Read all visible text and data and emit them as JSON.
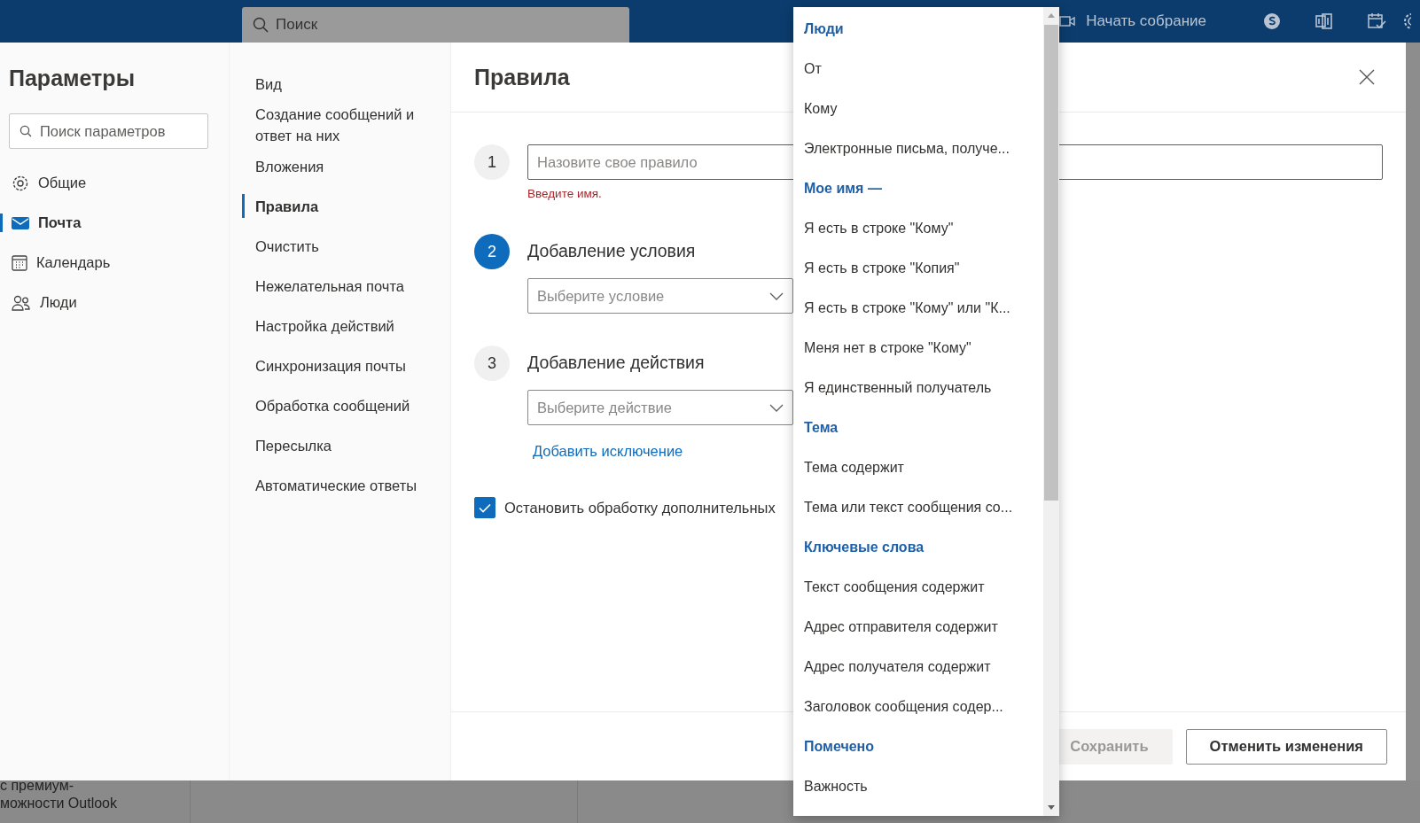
{
  "top_bar": {
    "search": {
      "placeholder": "Поиск"
    },
    "meeting_button": "Начать собрание"
  },
  "settings": {
    "title": "Параметры",
    "search": {
      "placeholder": "Поиск параметров"
    },
    "categories": [
      {
        "label": "Общие",
        "selected": false
      },
      {
        "label": "Почта",
        "selected": true
      },
      {
        "label": "Календарь",
        "selected": false
      },
      {
        "label": "Люди",
        "selected": false
      }
    ]
  },
  "sections": [
    {
      "label": "Вид",
      "selected": false
    },
    {
      "label": "Создание сообщений и ответ на них",
      "selected": false
    },
    {
      "label": "Вложения",
      "selected": false
    },
    {
      "label": "Правила",
      "selected": true
    },
    {
      "label": "Очистить",
      "selected": false
    },
    {
      "label": "Нежелательная почта",
      "selected": false
    },
    {
      "label": "Настройка действий",
      "selected": false
    },
    {
      "label": "Синхронизация почты",
      "selected": false
    },
    {
      "label": "Обработка сообщений",
      "selected": false
    },
    {
      "label": "Пересылка",
      "selected": false
    },
    {
      "label": "Автоматические ответы",
      "selected": false
    }
  ],
  "rules": {
    "title": "Правила",
    "steps": [
      {
        "number": "1",
        "kind": "input",
        "active": false,
        "placeholder": "Назовите свое правило",
        "error": "Введите имя."
      },
      {
        "number": "2",
        "kind": "select",
        "active": true,
        "label": "Добавление условия",
        "placeholder": "Выберите условие"
      },
      {
        "number": "3",
        "kind": "select",
        "active": false,
        "label": "Добавление действия",
        "placeholder": "Выберите действие",
        "link": "Добавить исключение"
      }
    ],
    "stop_processing": {
      "label": "Остановить обработку дополнительных",
      "checked": true
    },
    "buttons": [
      {
        "label": "Сохранить",
        "disabled": true
      },
      {
        "label": "Отменить изменения",
        "disabled": false
      }
    ]
  },
  "condition_menu": {
    "items": [
      {
        "kind": "header",
        "label": "Люди"
      },
      {
        "kind": "option",
        "label": "От"
      },
      {
        "kind": "option",
        "label": "Кому"
      },
      {
        "kind": "option",
        "label": "Электронные письма, получе..."
      },
      {
        "kind": "header",
        "label": "Мое имя —"
      },
      {
        "kind": "option",
        "label": "Я есть в строке \"Кому\""
      },
      {
        "kind": "option",
        "label": "Я есть в строке \"Копия\""
      },
      {
        "kind": "option",
        "label": "Я есть в строке \"Кому\" или \"К..."
      },
      {
        "kind": "option",
        "label": "Меня нет в строке \"Кому\""
      },
      {
        "kind": "option",
        "label": "Я единственный получатель"
      },
      {
        "kind": "header",
        "label": "Тема"
      },
      {
        "kind": "option",
        "label": "Тема содержит"
      },
      {
        "kind": "option",
        "label": "Тема или текст сообщения со..."
      },
      {
        "kind": "header",
        "label": "Ключевые слова"
      },
      {
        "kind": "option",
        "label": "Текст сообщения содержит"
      },
      {
        "kind": "option",
        "label": "Адрес отправителя содержит"
      },
      {
        "kind": "option",
        "label": "Адрес получателя содержит"
      },
      {
        "kind": "option",
        "label": "Заголовок сообщения содер..."
      },
      {
        "kind": "header",
        "label": "Помечено"
      },
      {
        "kind": "option",
        "label": "Важность"
      }
    ]
  },
  "background": {
    "promo_lines": [
      "с премиум-",
      "можности Outlook"
    ]
  }
}
